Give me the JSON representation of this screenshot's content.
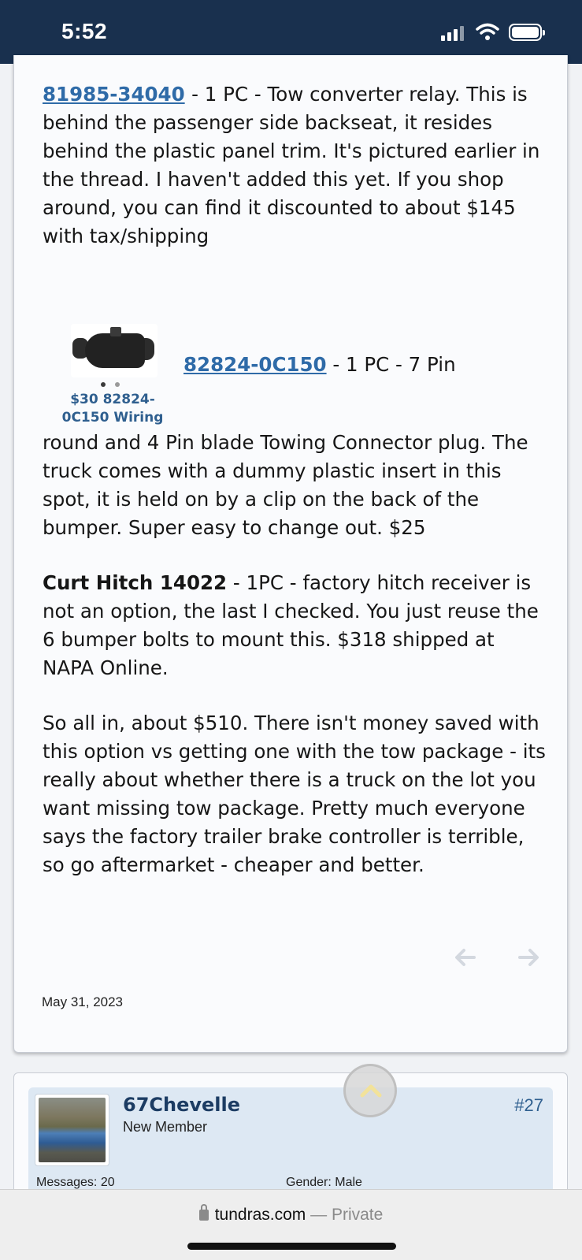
{
  "status_bar": {
    "time": "5:52"
  },
  "post": {
    "relay_part_number": "81985-34040",
    "relay_text": " - 1 PC - Tow converter relay. This is behind the passenger side backseat, it resides behind the plastic panel trim. It's pictured earlier in the thread. I haven't added this yet. If you shop around, you can find it discounted to about $145 with tax/shipping",
    "connector_part_number": "82824-0C150",
    "connector_text_inline": " - 1 PC - 7 Pin",
    "connector_thumb_caption": "$30 82824-0C150 Wiring",
    "connector_text_rest": "round and 4 Pin blade Towing Connector plug. The truck comes with a dummy plastic insert in this spot, it is held on by a clip on the back of the bumper. Super easy to change out. $25",
    "hitch_name": "Curt Hitch 14022",
    "hitch_text": " - 1PC - factory hitch receiver is not an option, the last I checked. You just reuse the 6 bumper bolts to mount this. $318 shipped at NAPA Online.",
    "summary_text": "So all in, about $510. There isn't money saved with this option vs getting one with the tow package - its really about whether there is a truck on the lot you want missing tow package. Pretty much everyone says the factory trailer brake controller is terrible, so go aftermarket - cheaper and better.",
    "date": "May 31, 2023"
  },
  "next_post": {
    "username": "67Chevelle",
    "user_title": "New Member",
    "post_number": "#27",
    "messages_stat": "Messages:  20",
    "gender_stat": "Gender:  Male"
  },
  "browser": {
    "domain": "tundras.com",
    "separator": " — ",
    "mode": "Private"
  },
  "icons": {
    "prev": "arrow-left-icon",
    "next": "arrow-right-icon",
    "scroll_top": "chevron-up-icon"
  },
  "colors": {
    "header_bg": "#19304e",
    "link": "#2f6ba8",
    "user_panel": "#dde8f3"
  }
}
